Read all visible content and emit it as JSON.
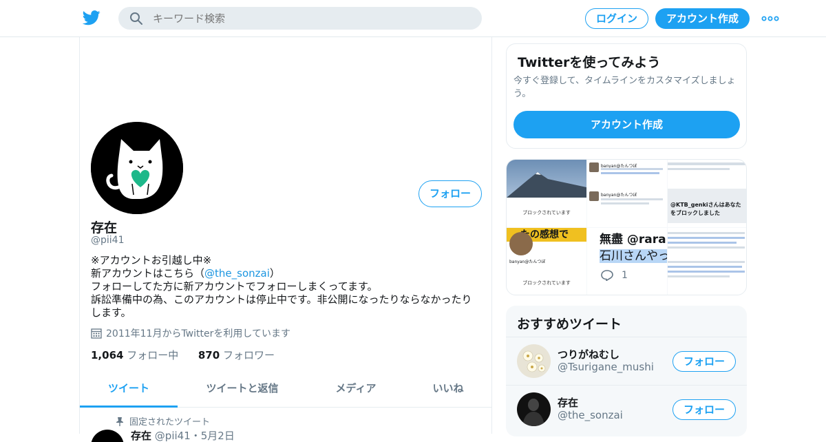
{
  "header": {
    "search_placeholder": "キーワード検索",
    "login_label": "ログイン",
    "signup_label": "アカウント作成"
  },
  "profile": {
    "follow_label": "フォロー",
    "name": "存在",
    "handle": "@pii41",
    "bio": {
      "line1": "※アカウントお引越し中※",
      "line2_prefix": "新アカウントはこちら（",
      "line2_link": "@the_sonzai",
      "line2_suffix": "）",
      "line3": "フォローしてた方に新アカウントでフォローしまくってます。",
      "line4": "訴訟準備中の為、このアカウントは停止中です。非公開になったりならなかったりします。"
    },
    "joined": "2011年11月からTwitterを利用しています",
    "following_count": "1,064",
    "following_label": "フォロー中",
    "followers_count": "870",
    "followers_label": "フォロワー"
  },
  "tabs": [
    {
      "label": "ツイート",
      "active": true
    },
    {
      "label": "ツイートと返信",
      "active": false
    },
    {
      "label": "メディア",
      "active": false
    },
    {
      "label": "いいね",
      "active": false
    }
  ],
  "pinned": {
    "label": "固定されたツイート",
    "name": "存在",
    "meta": "@pii41・5月2日"
  },
  "signup_card": {
    "title": "Twitterを使ってみよう",
    "text": "今すぐ登録して、タイムラインをカスタマイズしましょう。",
    "button": "アカウント作成"
  },
  "media_tiles": {
    "blocked_text": "ブロックされています",
    "user": "banyan@たんつぼ",
    "ktb_block": "@KTB_genkiさんはあなたをブロックしました",
    "muzin": "無盡 @rarara",
    "ishikawa": "石川さんやっ",
    "reply_count": "1",
    "kansou": "たの感想で"
  },
  "recommend": {
    "title": "おすすめツイート",
    "items": [
      {
        "name": "つりがねむし",
        "handle": "@Tsurigane_mushi",
        "follow": "フォロー"
      },
      {
        "name": "存在",
        "handle": "@the_sonzai",
        "follow": "フォロー"
      }
    ]
  },
  "colors": {
    "accent": "#1da1f2",
    "text": "#14171a",
    "muted": "#657786"
  }
}
